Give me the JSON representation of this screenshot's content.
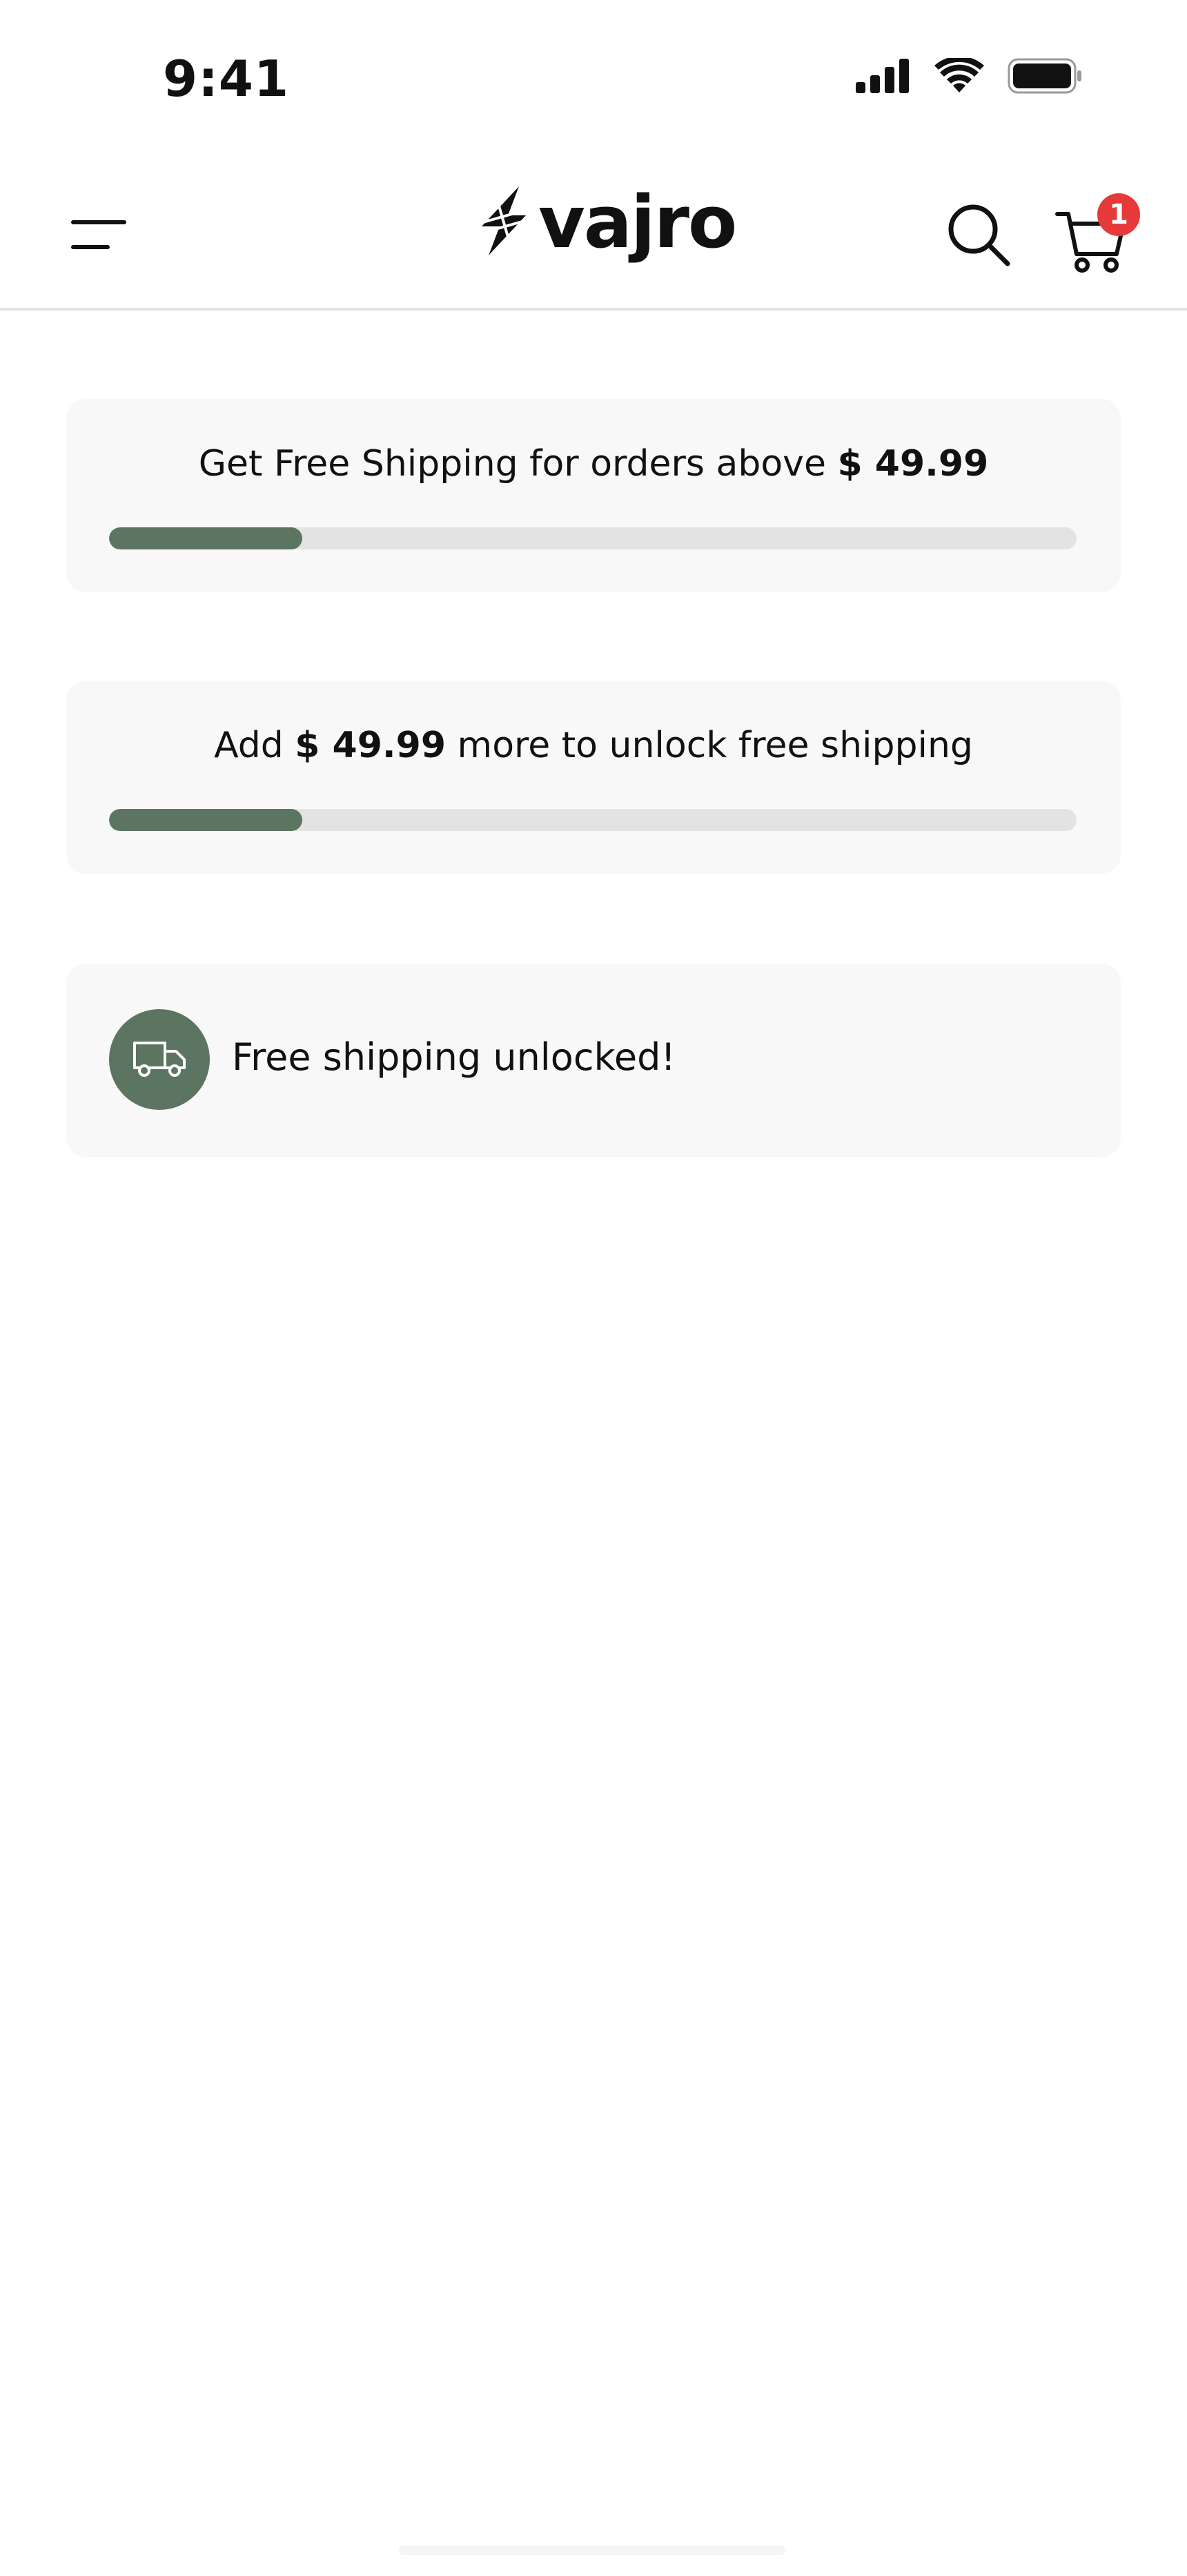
{
  "status_bar": {
    "time": "9:41",
    "icons": [
      "cellular-signal-icon",
      "wifi-icon",
      "battery-icon"
    ]
  },
  "header": {
    "brand_name": "vajro",
    "cart_count": "1",
    "icons": [
      "hamburger-menu-icon",
      "vajro-logo-icon",
      "search-icon",
      "cart-icon"
    ]
  },
  "shipping_cards": [
    {
      "text_before": "Get Free Shipping for orders above ",
      "amount": "$ 49.99",
      "text_after": "",
      "progress": 0.2
    },
    {
      "text_before": "Add ",
      "amount": "$ 49.99",
      "text_after": " more to unlock free shipping",
      "progress": 0.2
    }
  ],
  "unlocked_card": {
    "text": "Free shipping unlocked!",
    "icon": "truck-icon"
  },
  "colors": {
    "accent": "#5b7561",
    "track": "#e3e3e3",
    "card_bg": "#f8f8f8",
    "badge": "#e5393a"
  }
}
